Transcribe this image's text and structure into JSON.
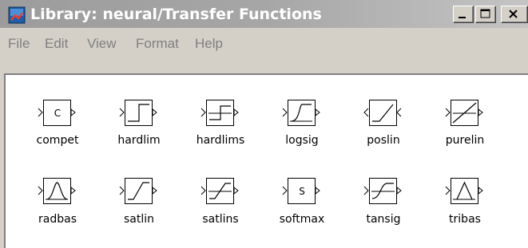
{
  "window": {
    "title": "Library: neural/Transfer Functions",
    "controls": {
      "minimize": "_",
      "maximize": "□",
      "close": "×"
    }
  },
  "menu": [
    {
      "label": "File"
    },
    {
      "label": "Edit"
    },
    {
      "label": "View"
    },
    {
      "label": "Format"
    },
    {
      "label": "Help"
    }
  ],
  "blocks": [
    {
      "name": "compet",
      "icon": "compet-icon",
      "text": "C"
    },
    {
      "name": "hardlim",
      "icon": "hardlim-icon"
    },
    {
      "name": "hardlims",
      "icon": "hardlims-icon"
    },
    {
      "name": "logsig",
      "icon": "logsig-icon"
    },
    {
      "name": "poslin",
      "icon": "poslin-icon"
    },
    {
      "name": "purelin",
      "icon": "purelin-icon"
    },
    {
      "name": "radbas",
      "icon": "radbas-icon"
    },
    {
      "name": "satlin",
      "icon": "satlin-icon"
    },
    {
      "name": "satlins",
      "icon": "satlins-icon"
    },
    {
      "name": "softmax",
      "icon": "softmax-icon",
      "text": "S"
    },
    {
      "name": "tansig",
      "icon": "tansig-icon"
    },
    {
      "name": "tribas",
      "icon": "tribas-icon"
    }
  ]
}
